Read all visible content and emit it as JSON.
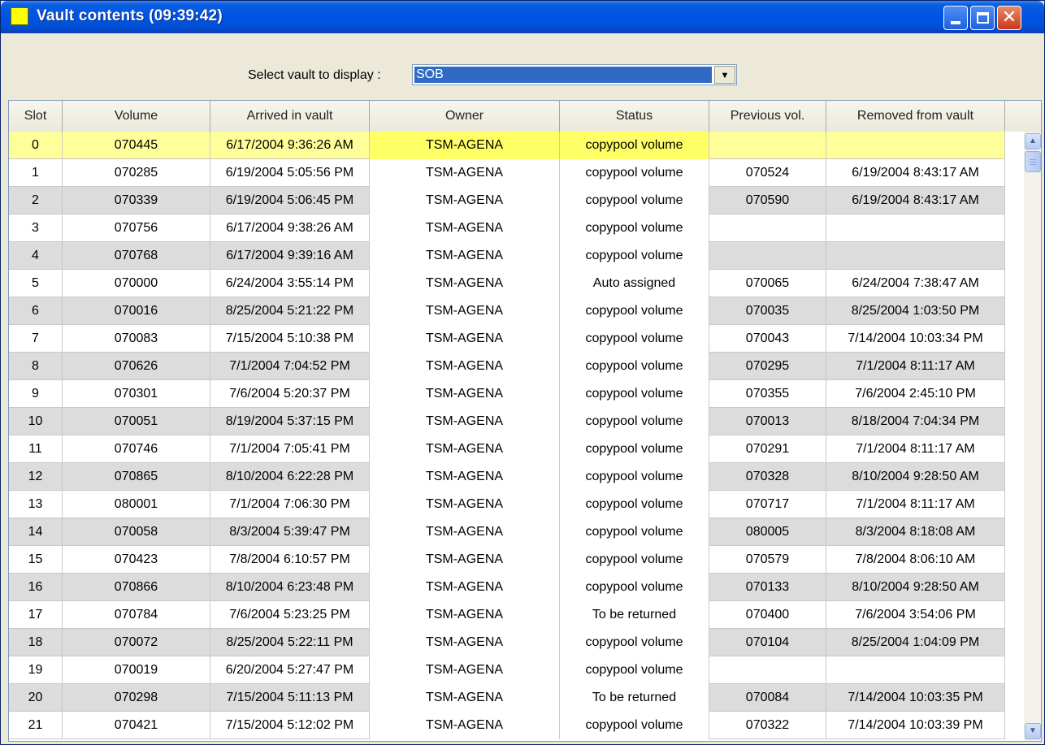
{
  "window": {
    "title": "Vault contents  (09:39:42)",
    "accent": "#0054e3",
    "icon_color": "#ffff00"
  },
  "selector": {
    "label": "Select vault to display :",
    "value": "SOB"
  },
  "table": {
    "columns": [
      "Slot",
      "Volume",
      "Arrived in vault",
      "Owner",
      "Status",
      "Previous vol.",
      "Removed from vault"
    ],
    "selected_row_color": "#ffff99",
    "rows": [
      [
        "0",
        "070445",
        "6/17/2004 9:36:26 AM",
        "TSM-AGENA",
        "copypool volume",
        "",
        ""
      ],
      [
        "1",
        "070285",
        "6/19/2004 5:05:56 PM",
        "TSM-AGENA",
        "copypool volume",
        "070524",
        "6/19/2004 8:43:17 AM"
      ],
      [
        "2",
        "070339",
        "6/19/2004 5:06:45 PM",
        "TSM-AGENA",
        "copypool volume",
        "070590",
        "6/19/2004 8:43:17 AM"
      ],
      [
        "3",
        "070756",
        "6/17/2004 9:38:26 AM",
        "TSM-AGENA",
        "copypool volume",
        "",
        ""
      ],
      [
        "4",
        "070768",
        "6/17/2004 9:39:16 AM",
        "TSM-AGENA",
        "copypool volume",
        "",
        ""
      ],
      [
        "5",
        "070000",
        "6/24/2004 3:55:14 PM",
        "TSM-AGENA",
        "Auto assigned",
        "070065",
        "6/24/2004 7:38:47 AM"
      ],
      [
        "6",
        "070016",
        "8/25/2004 5:21:22 PM",
        "TSM-AGENA",
        "copypool volume",
        "070035",
        "8/25/2004 1:03:50 PM"
      ],
      [
        "7",
        "070083",
        "7/15/2004 5:10:38 PM",
        "TSM-AGENA",
        "copypool volume",
        "070043",
        "7/14/2004 10:03:34 PM"
      ],
      [
        "8",
        "070626",
        "7/1/2004 7:04:52 PM",
        "TSM-AGENA",
        "copypool volume",
        "070295",
        "7/1/2004 8:11:17 AM"
      ],
      [
        "9",
        "070301",
        "7/6/2004 5:20:37 PM",
        "TSM-AGENA",
        "copypool volume",
        "070355",
        "7/6/2004 2:45:10 PM"
      ],
      [
        "10",
        "070051",
        "8/19/2004 5:37:15 PM",
        "TSM-AGENA",
        "copypool volume",
        "070013",
        "8/18/2004 7:04:34 PM"
      ],
      [
        "11",
        "070746",
        "7/1/2004 7:05:41 PM",
        "TSM-AGENA",
        "copypool volume",
        "070291",
        "7/1/2004 8:11:17 AM"
      ],
      [
        "12",
        "070865",
        "8/10/2004 6:22:28 PM",
        "TSM-AGENA",
        "copypool volume",
        "070328",
        "8/10/2004 9:28:50 AM"
      ],
      [
        "13",
        "080001",
        "7/1/2004 7:06:30 PM",
        "TSM-AGENA",
        "copypool volume",
        "070717",
        "7/1/2004 8:11:17 AM"
      ],
      [
        "14",
        "070058",
        "8/3/2004 5:39:47 PM",
        "TSM-AGENA",
        "copypool volume",
        "080005",
        "8/3/2004 8:18:08 AM"
      ],
      [
        "15",
        "070423",
        "7/8/2004 6:10:57 PM",
        "TSM-AGENA",
        "copypool volume",
        "070579",
        "7/8/2004 8:06:10 AM"
      ],
      [
        "16",
        "070866",
        "8/10/2004 6:23:48 PM",
        "TSM-AGENA",
        "copypool volume",
        "070133",
        "8/10/2004 9:28:50 AM"
      ],
      [
        "17",
        "070784",
        "7/6/2004 5:23:25 PM",
        "TSM-AGENA",
        "To be returned",
        "070400",
        "7/6/2004 3:54:06 PM"
      ],
      [
        "18",
        "070072",
        "8/25/2004 5:22:11 PM",
        "TSM-AGENA",
        "copypool volume",
        "070104",
        "8/25/2004 1:04:09 PM"
      ],
      [
        "19",
        "070019",
        "6/20/2004 5:27:47 PM",
        "TSM-AGENA",
        "copypool volume",
        "",
        ""
      ],
      [
        "20",
        "070298",
        "7/15/2004 5:11:13 PM",
        "TSM-AGENA",
        "To be returned",
        "070084",
        "7/14/2004 10:03:35 PM"
      ],
      [
        "21",
        "070421",
        "7/15/2004 5:12:02 PM",
        "TSM-AGENA",
        "copypool volume",
        "070322",
        "7/14/2004 10:03:39 PM"
      ]
    ]
  },
  "icons": {
    "minimize": "minimize-icon",
    "maximize": "maximize-icon",
    "close": "close-icon",
    "dropdown": "chevron-down-icon",
    "scroll_up": "scroll-up-icon",
    "scroll_down": "scroll-down-icon"
  }
}
